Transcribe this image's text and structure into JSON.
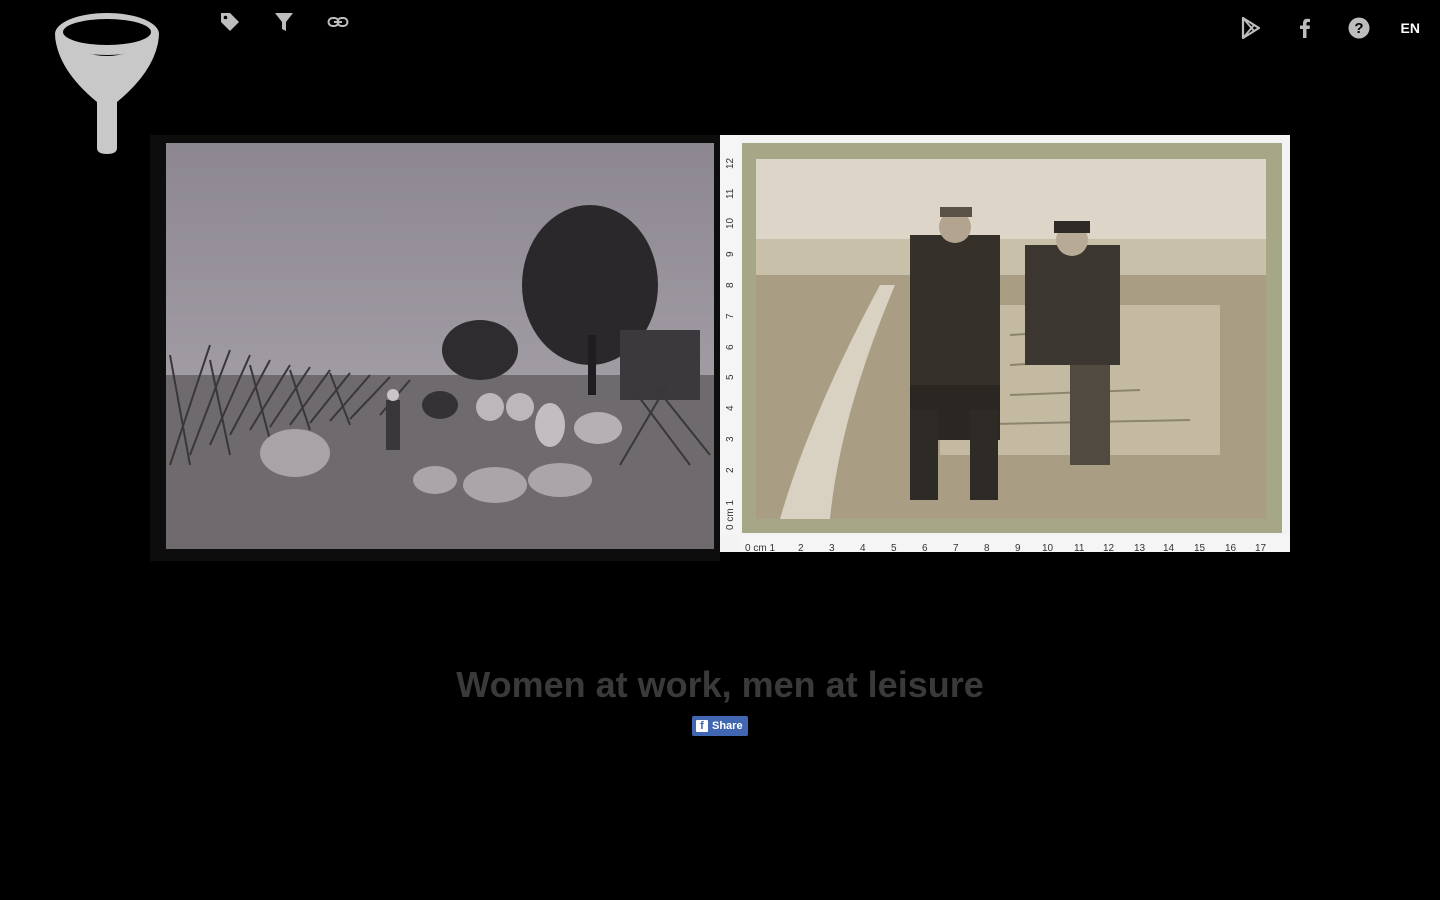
{
  "header": {
    "logo_icon": "funnel-icon",
    "tools": [
      {
        "icon": "tag-icon"
      },
      {
        "icon": "filter-icon"
      },
      {
        "icon": "link-icon"
      }
    ],
    "right": {
      "store_icon": "google-play-icon",
      "social_icon": "facebook-icon",
      "help_icon": "help-icon",
      "language": "EN"
    }
  },
  "main": {
    "left_photo": {
      "description_icon": "photo-farm-pigs"
    },
    "right_photo": {
      "description_icon": "photo-two-men-sitting",
      "ruler_numbers": [
        "0 cm 1",
        "2",
        "3",
        "4",
        "5",
        "6",
        "7",
        "8",
        "9",
        "10",
        "11",
        "12",
        "13",
        "14",
        "15",
        "16",
        "17"
      ],
      "ruler_side_numbers": [
        "0 cm 1",
        "2",
        "3",
        "4",
        "5",
        "6",
        "7",
        "8",
        "9",
        "10",
        "11",
        "12"
      ]
    },
    "caption": "Women at work, men at leisure",
    "share_label": "Share"
  },
  "colors": {
    "background": "#000000",
    "caption": "#3a3a3a",
    "share_button": "#4267b2",
    "icon": "#bdbdbd"
  }
}
